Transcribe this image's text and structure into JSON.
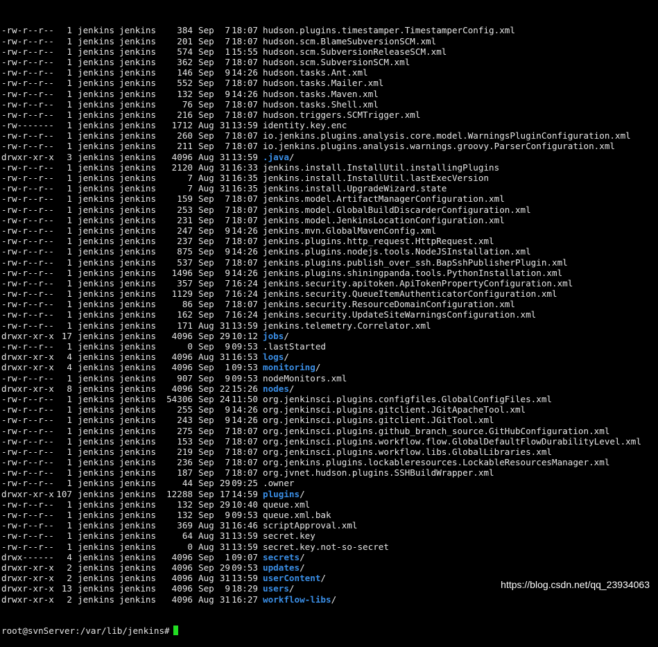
{
  "terminal": {
    "rows": [
      {
        "perm": "-rw-r--r--",
        "links": "1",
        "owner": "jenkins",
        "group": "jenkins",
        "size": "384",
        "month": "Sep",
        "day": "7",
        "time": "18:07",
        "name": "hudson.plugins.timestamper.TimestamperConfig.xml",
        "dir": false
      },
      {
        "perm": "-rw-r--r--",
        "links": "1",
        "owner": "jenkins",
        "group": "jenkins",
        "size": "201",
        "month": "Sep",
        "day": "7",
        "time": "18:07",
        "name": "hudson.scm.BlameSubversionSCM.xml",
        "dir": false
      },
      {
        "perm": "-rw-r--r--",
        "links": "1",
        "owner": "jenkins",
        "group": "jenkins",
        "size": "574",
        "month": "Sep",
        "day": "1",
        "time": "15:55",
        "name": "hudson.scm.SubversionReleaseSCM.xml",
        "dir": false
      },
      {
        "perm": "-rw-r--r--",
        "links": "1",
        "owner": "jenkins",
        "group": "jenkins",
        "size": "362",
        "month": "Sep",
        "day": "7",
        "time": "18:07",
        "name": "hudson.scm.SubversionSCM.xml",
        "dir": false
      },
      {
        "perm": "-rw-r--r--",
        "links": "1",
        "owner": "jenkins",
        "group": "jenkins",
        "size": "146",
        "month": "Sep",
        "day": "9",
        "time": "14:26",
        "name": "hudson.tasks.Ant.xml",
        "dir": false
      },
      {
        "perm": "-rw-r--r--",
        "links": "1",
        "owner": "jenkins",
        "group": "jenkins",
        "size": "552",
        "month": "Sep",
        "day": "7",
        "time": "18:07",
        "name": "hudson.tasks.Mailer.xml",
        "dir": false
      },
      {
        "perm": "-rw-r--r--",
        "links": "1",
        "owner": "jenkins",
        "group": "jenkins",
        "size": "132",
        "month": "Sep",
        "day": "9",
        "time": "14:26",
        "name": "hudson.tasks.Maven.xml",
        "dir": false
      },
      {
        "perm": "-rw-r--r--",
        "links": "1",
        "owner": "jenkins",
        "group": "jenkins",
        "size": "76",
        "month": "Sep",
        "day": "7",
        "time": "18:07",
        "name": "hudson.tasks.Shell.xml",
        "dir": false
      },
      {
        "perm": "-rw-r--r--",
        "links": "1",
        "owner": "jenkins",
        "group": "jenkins",
        "size": "216",
        "month": "Sep",
        "day": "7",
        "time": "18:07",
        "name": "hudson.triggers.SCMTrigger.xml",
        "dir": false
      },
      {
        "perm": "-rw-------",
        "links": "1",
        "owner": "jenkins",
        "group": "jenkins",
        "size": "1712",
        "month": "Aug",
        "day": "31",
        "time": "13:59",
        "name": "identity.key.enc",
        "dir": false
      },
      {
        "perm": "-rw-r--r--",
        "links": "1",
        "owner": "jenkins",
        "group": "jenkins",
        "size": "260",
        "month": "Sep",
        "day": "7",
        "time": "18:07",
        "name": "io.jenkins.plugins.analysis.core.model.WarningsPluginConfiguration.xml",
        "dir": false
      },
      {
        "perm": "-rw-r--r--",
        "links": "1",
        "owner": "jenkins",
        "group": "jenkins",
        "size": "211",
        "month": "Sep",
        "day": "7",
        "time": "18:07",
        "name": "io.jenkins.plugins.analysis.warnings.groovy.ParserConfiguration.xml",
        "dir": false
      },
      {
        "perm": "drwxr-xr-x",
        "links": "3",
        "owner": "jenkins",
        "group": "jenkins",
        "size": "4096",
        "month": "Aug",
        "day": "31",
        "time": "13:59",
        "name": ".java",
        "dir": true
      },
      {
        "perm": "-rw-r--r--",
        "links": "1",
        "owner": "jenkins",
        "group": "jenkins",
        "size": "2120",
        "month": "Aug",
        "day": "31",
        "time": "16:33",
        "name": "jenkins.install.InstallUtil.installingPlugins",
        "dir": false
      },
      {
        "perm": "-rw-r--r--",
        "links": "1",
        "owner": "jenkins",
        "group": "jenkins",
        "size": "7",
        "month": "Aug",
        "day": "31",
        "time": "16:35",
        "name": "jenkins.install.InstallUtil.lastExecVersion",
        "dir": false
      },
      {
        "perm": "-rw-r--r--",
        "links": "1",
        "owner": "jenkins",
        "group": "jenkins",
        "size": "7",
        "month": "Aug",
        "day": "31",
        "time": "16:35",
        "name": "jenkins.install.UpgradeWizard.state",
        "dir": false
      },
      {
        "perm": "-rw-r--r--",
        "links": "1",
        "owner": "jenkins",
        "group": "jenkins",
        "size": "159",
        "month": "Sep",
        "day": "7",
        "time": "18:07",
        "name": "jenkins.model.ArtifactManagerConfiguration.xml",
        "dir": false
      },
      {
        "perm": "-rw-r--r--",
        "links": "1",
        "owner": "jenkins",
        "group": "jenkins",
        "size": "253",
        "month": "Sep",
        "day": "7",
        "time": "18:07",
        "name": "jenkins.model.GlobalBuildDiscarderConfiguration.xml",
        "dir": false
      },
      {
        "perm": "-rw-r--r--",
        "links": "1",
        "owner": "jenkins",
        "group": "jenkins",
        "size": "231",
        "month": "Sep",
        "day": "7",
        "time": "18:07",
        "name": "jenkins.model.JenkinsLocationConfiguration.xml",
        "dir": false
      },
      {
        "perm": "-rw-r--r--",
        "links": "1",
        "owner": "jenkins",
        "group": "jenkins",
        "size": "247",
        "month": "Sep",
        "day": "9",
        "time": "14:26",
        "name": "jenkins.mvn.GlobalMavenConfig.xml",
        "dir": false
      },
      {
        "perm": "-rw-r--r--",
        "links": "1",
        "owner": "jenkins",
        "group": "jenkins",
        "size": "237",
        "month": "Sep",
        "day": "7",
        "time": "18:07",
        "name": "jenkins.plugins.http_request.HttpRequest.xml",
        "dir": false
      },
      {
        "perm": "-rw-r--r--",
        "links": "1",
        "owner": "jenkins",
        "group": "jenkins",
        "size": "875",
        "month": "Sep",
        "day": "9",
        "time": "14:26",
        "name": "jenkins.plugins.nodejs.tools.NodeJSInstallation.xml",
        "dir": false
      },
      {
        "perm": "-rw-r--r--",
        "links": "1",
        "owner": "jenkins",
        "group": "jenkins",
        "size": "537",
        "month": "Sep",
        "day": "7",
        "time": "18:07",
        "name": "jenkins.plugins.publish_over_ssh.BapSshPublisherPlugin.xml",
        "dir": false
      },
      {
        "perm": "-rw-r--r--",
        "links": "1",
        "owner": "jenkins",
        "group": "jenkins",
        "size": "1496",
        "month": "Sep",
        "day": "9",
        "time": "14:26",
        "name": "jenkins.plugins.shiningpanda.tools.PythonInstallation.xml",
        "dir": false
      },
      {
        "perm": "-rw-r--r--",
        "links": "1",
        "owner": "jenkins",
        "group": "jenkins",
        "size": "357",
        "month": "Sep",
        "day": "7",
        "time": "16:24",
        "name": "jenkins.security.apitoken.ApiTokenPropertyConfiguration.xml",
        "dir": false
      },
      {
        "perm": "-rw-r--r--",
        "links": "1",
        "owner": "jenkins",
        "group": "jenkins",
        "size": "1129",
        "month": "Sep",
        "day": "7",
        "time": "16:24",
        "name": "jenkins.security.QueueItemAuthenticatorConfiguration.xml",
        "dir": false
      },
      {
        "perm": "-rw-r--r--",
        "links": "1",
        "owner": "jenkins",
        "group": "jenkins",
        "size": "86",
        "month": "Sep",
        "day": "7",
        "time": "18:07",
        "name": "jenkins.security.ResourceDomainConfiguration.xml",
        "dir": false
      },
      {
        "perm": "-rw-r--r--",
        "links": "1",
        "owner": "jenkins",
        "group": "jenkins",
        "size": "162",
        "month": "Sep",
        "day": "7",
        "time": "16:24",
        "name": "jenkins.security.UpdateSiteWarningsConfiguration.xml",
        "dir": false
      },
      {
        "perm": "-rw-r--r--",
        "links": "1",
        "owner": "jenkins",
        "group": "jenkins",
        "size": "171",
        "month": "Aug",
        "day": "31",
        "time": "13:59",
        "name": "jenkins.telemetry.Correlator.xml",
        "dir": false
      },
      {
        "perm": "drwxr-xr-x",
        "links": "17",
        "owner": "jenkins",
        "group": "jenkins",
        "size": "4096",
        "month": "Sep",
        "day": "29",
        "time": "10:12",
        "name": "jobs",
        "dir": true
      },
      {
        "perm": "-rw-r--r--",
        "links": "1",
        "owner": "jenkins",
        "group": "jenkins",
        "size": "0",
        "month": "Sep",
        "day": "9",
        "time": "09:53",
        "name": ".lastStarted",
        "dir": false
      },
      {
        "perm": "drwxr-xr-x",
        "links": "4",
        "owner": "jenkins",
        "group": "jenkins",
        "size": "4096",
        "month": "Aug",
        "day": "31",
        "time": "16:53",
        "name": "logs",
        "dir": true
      },
      {
        "perm": "drwxr-xr-x",
        "links": "4",
        "owner": "jenkins",
        "group": "jenkins",
        "size": "4096",
        "month": "Sep",
        "day": "1",
        "time": "09:53",
        "name": "monitoring",
        "dir": true
      },
      {
        "perm": "-rw-r--r--",
        "links": "1",
        "owner": "jenkins",
        "group": "jenkins",
        "size": "907",
        "month": "Sep",
        "day": "9",
        "time": "09:53",
        "name": "nodeMonitors.xml",
        "dir": false
      },
      {
        "perm": "drwxr-xr-x",
        "links": "8",
        "owner": "jenkins",
        "group": "jenkins",
        "size": "4096",
        "month": "Sep",
        "day": "22",
        "time": "15:26",
        "name": "nodes",
        "dir": true
      },
      {
        "perm": "-rw-r--r--",
        "links": "1",
        "owner": "jenkins",
        "group": "jenkins",
        "size": "54306",
        "month": "Sep",
        "day": "24",
        "time": "11:50",
        "name": "org.jenkinsci.plugins.configfiles.GlobalConfigFiles.xml",
        "dir": false
      },
      {
        "perm": "-rw-r--r--",
        "links": "1",
        "owner": "jenkins",
        "group": "jenkins",
        "size": "255",
        "month": "Sep",
        "day": "9",
        "time": "14:26",
        "name": "org.jenkinsci.plugins.gitclient.JGitApacheTool.xml",
        "dir": false
      },
      {
        "perm": "-rw-r--r--",
        "links": "1",
        "owner": "jenkins",
        "group": "jenkins",
        "size": "243",
        "month": "Sep",
        "day": "9",
        "time": "14:26",
        "name": "org.jenkinsci.plugins.gitclient.JGitTool.xml",
        "dir": false
      },
      {
        "perm": "-rw-r--r--",
        "links": "1",
        "owner": "jenkins",
        "group": "jenkins",
        "size": "275",
        "month": "Sep",
        "day": "7",
        "time": "18:07",
        "name": "org.jenkinsci.plugins.github_branch_source.GitHubConfiguration.xml",
        "dir": false
      },
      {
        "perm": "-rw-r--r--",
        "links": "1",
        "owner": "jenkins",
        "group": "jenkins",
        "size": "153",
        "month": "Sep",
        "day": "7",
        "time": "18:07",
        "name": "org.jenkinsci.plugins.workflow.flow.GlobalDefaultFlowDurabilityLevel.xml",
        "dir": false
      },
      {
        "perm": "-rw-r--r--",
        "links": "1",
        "owner": "jenkins",
        "group": "jenkins",
        "size": "219",
        "month": "Sep",
        "day": "7",
        "time": "18:07",
        "name": "org.jenkinsci.plugins.workflow.libs.GlobalLibraries.xml",
        "dir": false
      },
      {
        "perm": "-rw-r--r--",
        "links": "1",
        "owner": "jenkins",
        "group": "jenkins",
        "size": "236",
        "month": "Sep",
        "day": "7",
        "time": "18:07",
        "name": "org.jenkins.plugins.lockableresources.LockableResourcesManager.xml",
        "dir": false
      },
      {
        "perm": "-rw-r--r--",
        "links": "1",
        "owner": "jenkins",
        "group": "jenkins",
        "size": "187",
        "month": "Sep",
        "day": "7",
        "time": "18:07",
        "name": "org.jvnet.hudson.plugins.SSHBuildWrapper.xml",
        "dir": false
      },
      {
        "perm": "-rw-r--r--",
        "links": "1",
        "owner": "jenkins",
        "group": "jenkins",
        "size": "44",
        "month": "Sep",
        "day": "29",
        "time": "09:25",
        "name": ".owner",
        "dir": false
      },
      {
        "perm": "drwxr-xr-x",
        "links": "107",
        "owner": "jenkins",
        "group": "jenkins",
        "size": "12288",
        "month": "Sep",
        "day": "17",
        "time": "14:59",
        "name": "plugins",
        "dir": true
      },
      {
        "perm": "-rw-r--r--",
        "links": "1",
        "owner": "jenkins",
        "group": "jenkins",
        "size": "132",
        "month": "Sep",
        "day": "29",
        "time": "10:40",
        "name": "queue.xml",
        "dir": false
      },
      {
        "perm": "-rw-r--r--",
        "links": "1",
        "owner": "jenkins",
        "group": "jenkins",
        "size": "132",
        "month": "Sep",
        "day": "9",
        "time": "09:53",
        "name": "queue.xml.bak",
        "dir": false
      },
      {
        "perm": "-rw-r--r--",
        "links": "1",
        "owner": "jenkins",
        "group": "jenkins",
        "size": "369",
        "month": "Aug",
        "day": "31",
        "time": "16:46",
        "name": "scriptApproval.xml",
        "dir": false
      },
      {
        "perm": "-rw-r--r--",
        "links": "1",
        "owner": "jenkins",
        "group": "jenkins",
        "size": "64",
        "month": "Aug",
        "day": "31",
        "time": "13:59",
        "name": "secret.key",
        "dir": false
      },
      {
        "perm": "-rw-r--r--",
        "links": "1",
        "owner": "jenkins",
        "group": "jenkins",
        "size": "0",
        "month": "Aug",
        "day": "31",
        "time": "13:59",
        "name": "secret.key.not-so-secret",
        "dir": false
      },
      {
        "perm": "drwx------",
        "links": "4",
        "owner": "jenkins",
        "group": "jenkins",
        "size": "4096",
        "month": "Sep",
        "day": "1",
        "time": "09:07",
        "name": "secrets",
        "dir": true
      },
      {
        "perm": "drwxr-xr-x",
        "links": "2",
        "owner": "jenkins",
        "group": "jenkins",
        "size": "4096",
        "month": "Sep",
        "day": "29",
        "time": "09:53",
        "name": "updates",
        "dir": true
      },
      {
        "perm": "drwxr-xr-x",
        "links": "2",
        "owner": "jenkins",
        "group": "jenkins",
        "size": "4096",
        "month": "Aug",
        "day": "31",
        "time": "13:59",
        "name": "userContent",
        "dir": true
      },
      {
        "perm": "drwxr-xr-x",
        "links": "13",
        "owner": "jenkins",
        "group": "jenkins",
        "size": "4096",
        "month": "Sep",
        "day": "9",
        "time": "18:29",
        "name": "users",
        "dir": true
      },
      {
        "perm": "drwxr-xr-x",
        "links": "2",
        "owner": "jenkins",
        "group": "jenkins",
        "size": "4096",
        "month": "Aug",
        "day": "31",
        "time": "16:27",
        "name": "workflow-libs",
        "dir": true
      }
    ],
    "dir_suffix": "/",
    "prompt": "root@svnServer:/var/lib/jenkins#"
  },
  "watermark": "https://blog.csdn.net/qq_23934063",
  "colors": {
    "background": "#000000",
    "text": "#e6e6e6",
    "directory": "#3a8ee6",
    "cursor": "#22dd22"
  }
}
